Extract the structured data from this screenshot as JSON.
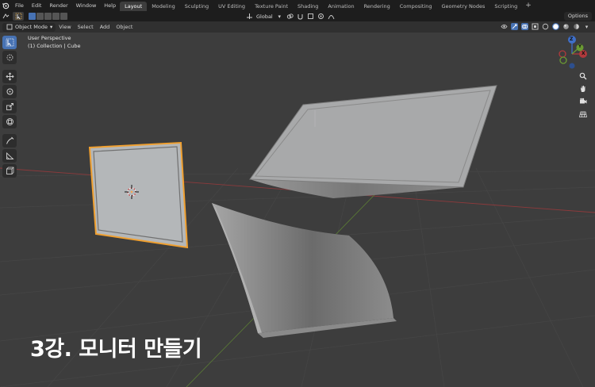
{
  "menu": [
    "File",
    "Edit",
    "Render",
    "Window",
    "Help"
  ],
  "workspaces": [
    {
      "label": "Layout",
      "active": true
    },
    {
      "label": "Modeling",
      "active": false
    },
    {
      "label": "Sculpting",
      "active": false
    },
    {
      "label": "UV Editing",
      "active": false
    },
    {
      "label": "Texture Paint",
      "active": false
    },
    {
      "label": "Shading",
      "active": false
    },
    {
      "label": "Animation",
      "active": false
    },
    {
      "label": "Rendering",
      "active": false
    },
    {
      "label": "Compositing",
      "active": false
    },
    {
      "label": "Geometry Nodes",
      "active": false
    },
    {
      "label": "Scripting",
      "active": false
    }
  ],
  "add_workspace": "+",
  "header": {
    "mode": "Object Mode",
    "view": "View",
    "select": "Select",
    "add": "Add",
    "object": "Object",
    "orientation": "Global",
    "options": "Options"
  },
  "viewport": {
    "perspective": "User Perspective",
    "collection": "(1) Collection | Cube"
  },
  "gizmo": {
    "z": "Z",
    "y": "Y",
    "x": "X"
  },
  "caption": "3강. 모니터 만들기",
  "colors": {
    "accent": "#4772b3",
    "selection_outline": "#f0a030",
    "background": "#3d3d3d",
    "axis_red": "#b0393c",
    "axis_green": "#6a9a33",
    "axis_blue": "#3f6fc8"
  }
}
